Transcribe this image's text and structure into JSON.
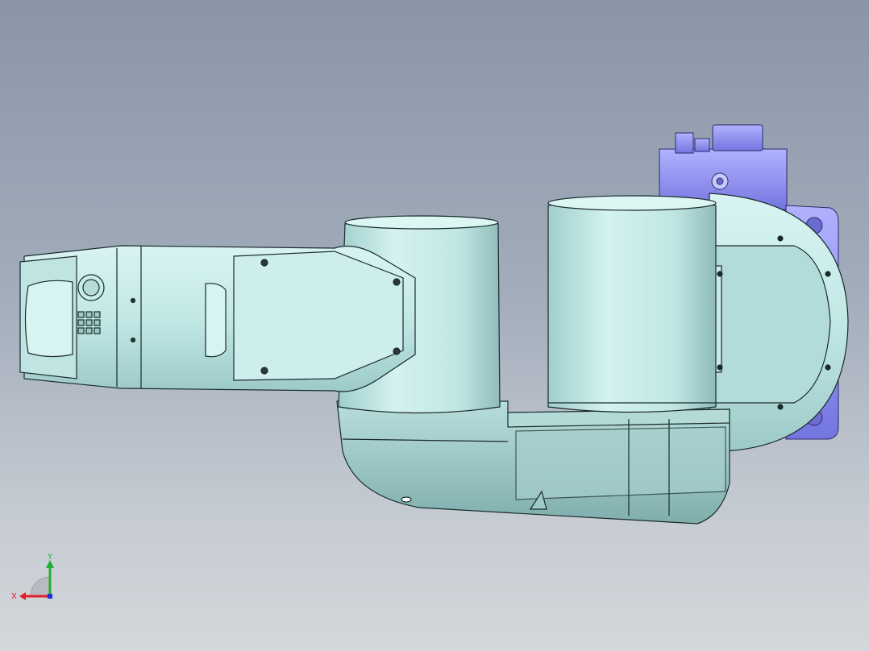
{
  "viewport": {
    "background_top": "#8a96a8",
    "background_bottom": "#d4d7db"
  },
  "model": {
    "body_color": "#c4e8e6",
    "body_shade": "#8fbcba",
    "edge_color": "#1a2a2a",
    "motor_color": "#8a8cf0",
    "motor_edge": "#2a2a6a"
  },
  "triad": {
    "x_label": "X",
    "y_label": "Y",
    "x_color": "#e0202a",
    "y_color": "#20b030",
    "z_color": "#2030e0"
  }
}
